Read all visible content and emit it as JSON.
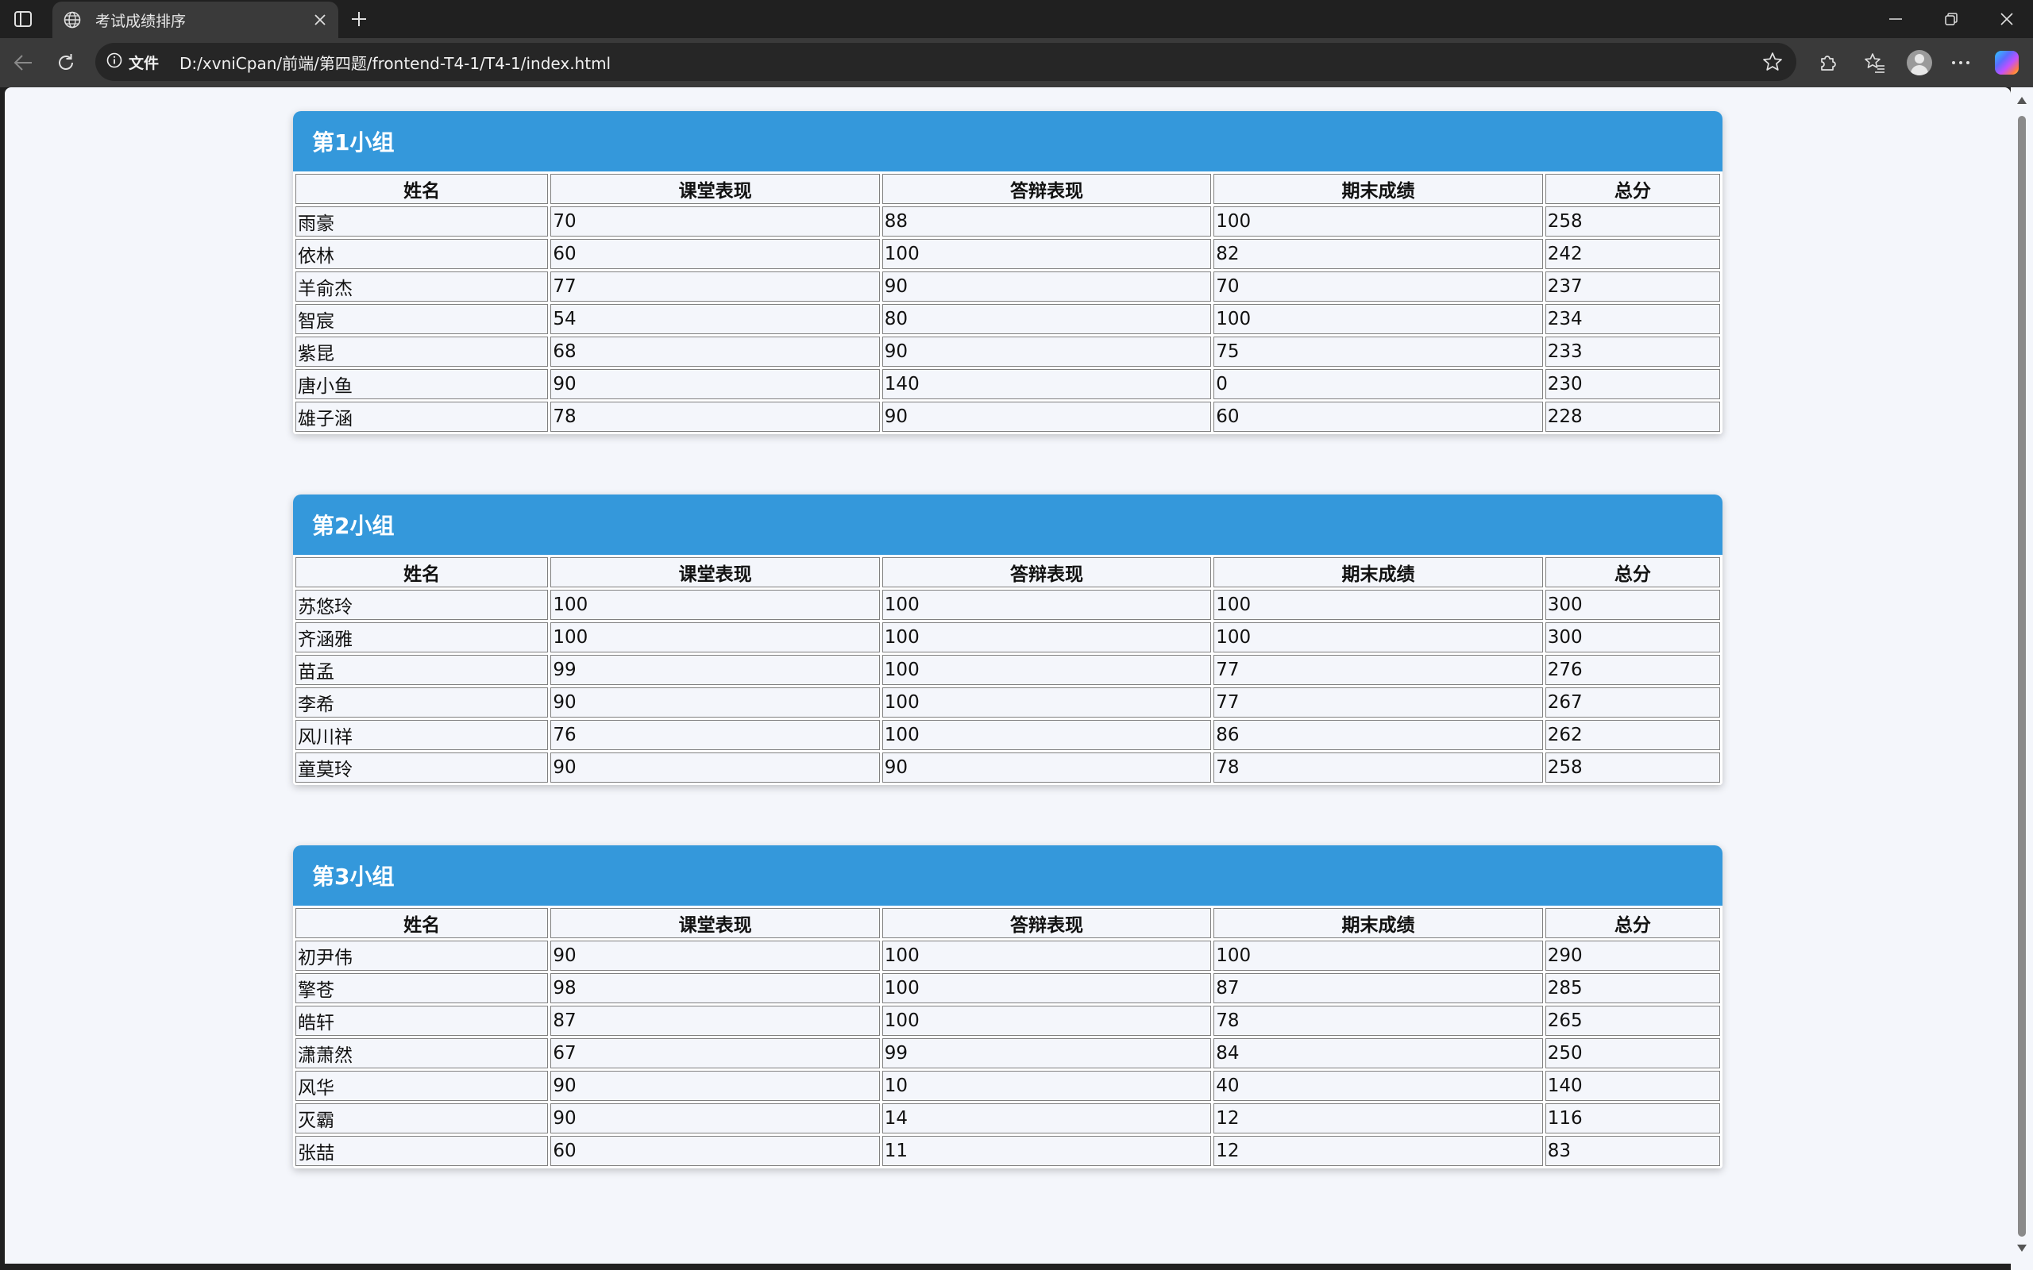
{
  "browser": {
    "tab_title": "考试成绩排序",
    "site_info_label": "文件",
    "url": "D:/xvniCpan/前端/第四题/frontend-T4-1/T4-1/index.html"
  },
  "table_headers": [
    "姓名",
    "课堂表现",
    "答辩表现",
    "期末成绩",
    "总分"
  ],
  "groups": [
    {
      "title": "第1小组",
      "rows": [
        [
          "雨豪",
          "70",
          "88",
          "100",
          "258"
        ],
        [
          "依林",
          "60",
          "100",
          "82",
          "242"
        ],
        [
          "羊俞杰",
          "77",
          "90",
          "70",
          "237"
        ],
        [
          "智宸",
          "54",
          "80",
          "100",
          "234"
        ],
        [
          "紫昆",
          "68",
          "90",
          "75",
          "233"
        ],
        [
          "唐小鱼",
          "90",
          "140",
          "0",
          "230"
        ],
        [
          "雄子涵",
          "78",
          "90",
          "60",
          "228"
        ]
      ]
    },
    {
      "title": "第2小组",
      "rows": [
        [
          "苏悠玲",
          "100",
          "100",
          "100",
          "300"
        ],
        [
          "齐涵雅",
          "100",
          "100",
          "100",
          "300"
        ],
        [
          "苗孟",
          "99",
          "100",
          "77",
          "276"
        ],
        [
          "李希",
          "90",
          "100",
          "77",
          "267"
        ],
        [
          "风川祥",
          "76",
          "100",
          "86",
          "262"
        ],
        [
          "童莫玲",
          "90",
          "90",
          "78",
          "258"
        ]
      ]
    },
    {
      "title": "第3小组",
      "rows": [
        [
          "初尹伟",
          "90",
          "100",
          "100",
          "290"
        ],
        [
          "擎苍",
          "98",
          "100",
          "87",
          "285"
        ],
        [
          "皓轩",
          "87",
          "100",
          "78",
          "265"
        ],
        [
          "潇萧然",
          "67",
          "99",
          "84",
          "250"
        ],
        [
          "风华",
          "90",
          "10",
          "40",
          "140"
        ],
        [
          "灭霸",
          "90",
          "14",
          "12",
          "116"
        ],
        [
          "张喆",
          "60",
          "11",
          "12",
          "83"
        ]
      ]
    }
  ]
}
